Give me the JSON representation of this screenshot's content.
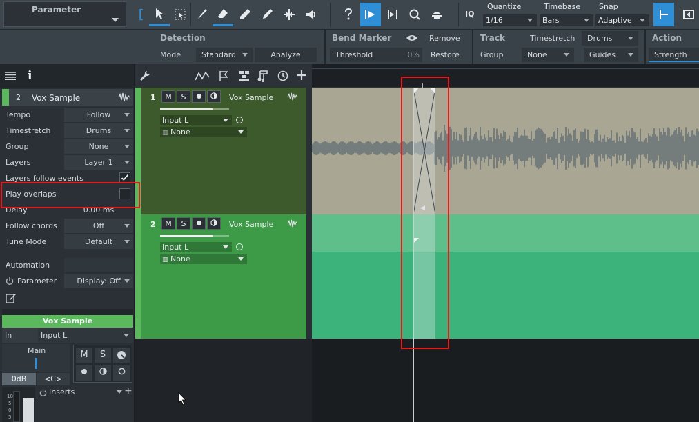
{
  "toolbar": {
    "parameter_label": "Parameter",
    "quantize": {
      "label": "Quantize",
      "value": "1/16"
    },
    "timebase": {
      "label": "Timebase",
      "value": "Bars"
    },
    "snap": {
      "label": "Snap",
      "value": "Adaptive"
    },
    "iq_label": "IQ",
    "accent": "#2f8fd6"
  },
  "strip": {
    "detection": {
      "title": "Detection",
      "mode_label": "Mode",
      "mode_value": "Standard",
      "analyze": "Analyze"
    },
    "bend_marker": {
      "title": "Bend Marker",
      "remove": "Remove",
      "threshold_label": "Threshold",
      "threshold_value": "0%",
      "restore": "Restore"
    },
    "track": {
      "title": "Track",
      "timestretch_label": "Timestretch",
      "timestretch_value": "Drums",
      "group_label": "Group",
      "group_value": "None",
      "guides": "Guides"
    },
    "action": {
      "title": "Action",
      "strength": "Strength"
    }
  },
  "inspector": {
    "track_number": "2",
    "track_name": "Vox Sample",
    "rows": {
      "tempo": {
        "label": "Tempo",
        "value": "Follow"
      },
      "timestretch": {
        "label": "Timestretch",
        "value": "Drums"
      },
      "group": {
        "label": "Group",
        "value": "None"
      },
      "layers": {
        "label": "Layers",
        "value": "Layer 1"
      },
      "layers_follow": {
        "label": "Layers follow events"
      },
      "play_overlaps": {
        "label": "Play overlaps"
      },
      "delay": {
        "label": "Delay",
        "value": "0.00 ms"
      },
      "follow_chords": {
        "label": "Follow chords",
        "value": "Off"
      },
      "tune_mode": {
        "label": "Tune Mode",
        "value": "Default"
      }
    },
    "automation": {
      "label": "Automation",
      "parameter": "Parameter",
      "display": "Display: Off"
    },
    "channel": {
      "title": "Vox Sample",
      "in_label": "In",
      "input": "Input L",
      "main": "Main",
      "volume": "0dB",
      "pan": "<C>",
      "inserts": "Inserts",
      "m": "M",
      "s": "S",
      "meter_ticks": [
        "10",
        "5",
        "0",
        "5"
      ]
    }
  },
  "tracks": [
    {
      "number": "1",
      "name": "Vox Sample",
      "m": "M",
      "s": "S",
      "input": "Input L",
      "output": "None",
      "color": "#3d5a2c",
      "lane_color": "#a9a793"
    },
    {
      "number": "2",
      "name": "Vox Sample",
      "m": "M",
      "s": "S",
      "input": "Input L",
      "output": "None",
      "color": "#3d9a47",
      "lane_color": "#5fbf8a"
    }
  ]
}
